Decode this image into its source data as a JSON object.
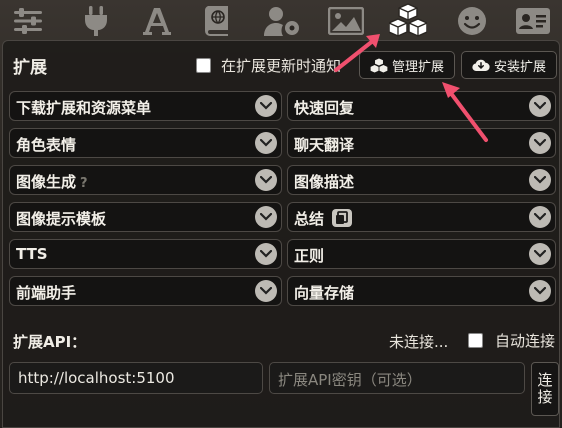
{
  "topbar": {
    "icons": [
      "sliders-icon",
      "plug-icon",
      "font-icon",
      "book-globe-icon",
      "user-gear-icon",
      "image-icon",
      "cubes-icon",
      "smiley-icon",
      "id-card-icon"
    ],
    "active": "cubes-icon"
  },
  "extensions": {
    "title": "扩展",
    "notify_label": "在扩展更新时通知",
    "notify_checked": false,
    "manage_label": "管理扩展",
    "install_label": "安装扩展"
  },
  "dropdowns": {
    "left": [
      "下载扩展和资源菜单",
      "角色表情",
      "图像生成",
      "图像提示模板",
      "TTS",
      "前端助手"
    ],
    "right": [
      "快速回复",
      "聊天翻译",
      "图像描述",
      "总结",
      "正则",
      "向量存储"
    ],
    "image_gen_hint": "?"
  },
  "api": {
    "title": "扩展API：",
    "status": "未连接...",
    "auto_connect_label": "自动连接",
    "auto_connect_checked": false,
    "url_value": "http://localhost:5100",
    "key_placeholder": "扩展API密钥（可选）",
    "connect_label": "连接"
  },
  "colors": {
    "accent_arrow": "#f0506e",
    "panel_bg": "#1e1c1a",
    "chevron_bg": "#bdbab4"
  }
}
